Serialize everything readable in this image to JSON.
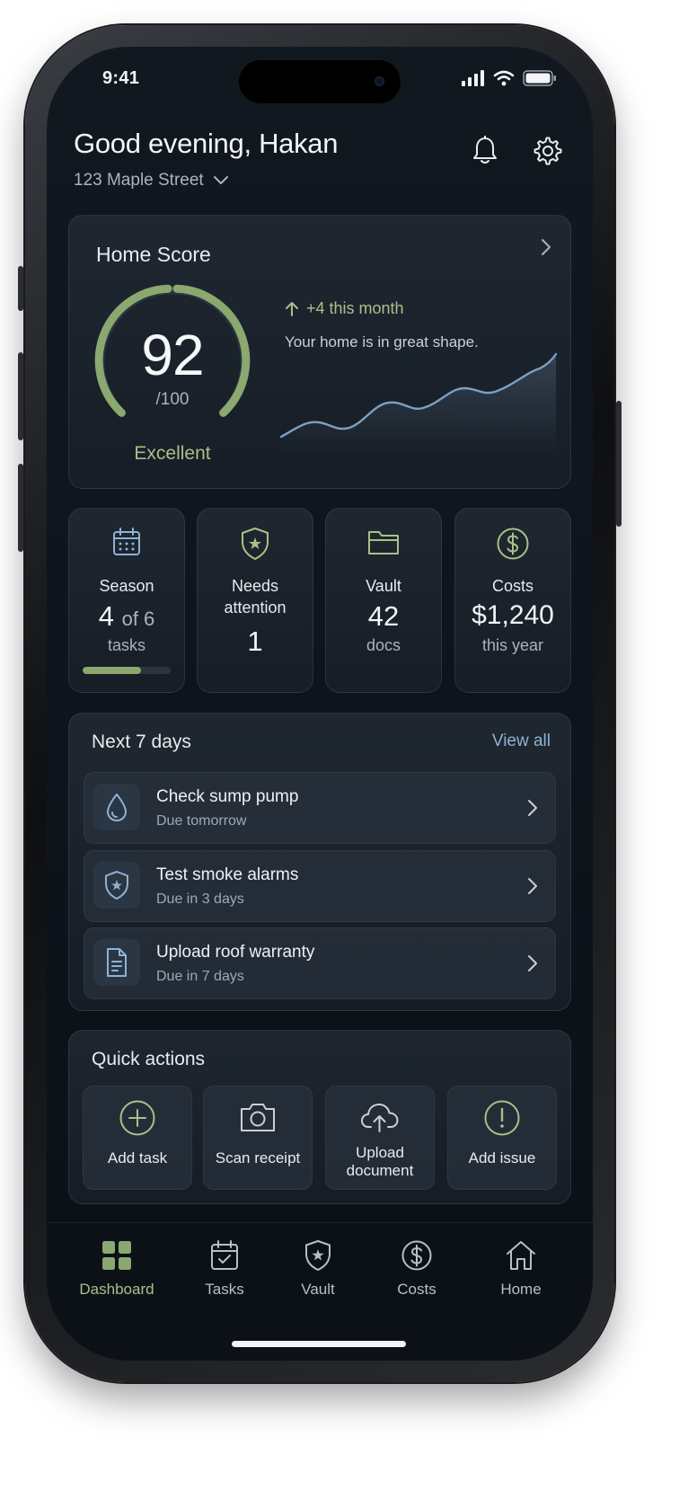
{
  "status_bar": {
    "time": "9:41"
  },
  "header": {
    "greeting": "Good evening, Hakan",
    "address": "123 Maple Street"
  },
  "home_score": {
    "title": "Home Score",
    "score": "92",
    "max": "/100",
    "rating": "Excellent",
    "score_fraction": 0.92,
    "trend": "+4 this month",
    "message": "Your home is in great shape."
  },
  "stats": {
    "season": {
      "title": "Season",
      "value": "4",
      "of": "of 6",
      "unit": "tasks",
      "progress": 0.667
    },
    "attention": {
      "title_line1": "Needs",
      "title_line2": "attention",
      "value": "1"
    },
    "vault": {
      "title": "Vault",
      "value": "42",
      "unit": "docs"
    },
    "costs": {
      "title": "Costs",
      "value": "$1,240",
      "unit": "this year"
    }
  },
  "next_days": {
    "title": "Next 7 days",
    "view_all": "View all",
    "tasks": [
      {
        "title": "Check sump pump",
        "due": "Due tomorrow"
      },
      {
        "title": "Test smoke alarms",
        "due": "Due in 3 days"
      },
      {
        "title": "Upload roof warranty",
        "due": "Due in 7 days"
      }
    ]
  },
  "quick_actions": {
    "title": "Quick actions",
    "items": [
      {
        "label": "Add task"
      },
      {
        "label": "Scan receipt"
      },
      {
        "label_line1": "Upload",
        "label_line2": "document"
      },
      {
        "label": "Add issue"
      }
    ]
  },
  "tabbar": {
    "tabs": [
      {
        "label": "Dashboard",
        "icon": "dashboard-icon",
        "active": true
      },
      {
        "label": "Tasks",
        "icon": "tasks-icon"
      },
      {
        "label": "Vault",
        "icon": "vault-icon"
      },
      {
        "label": "Costs",
        "icon": "costs-icon"
      },
      {
        "label": "Home",
        "icon": "home-icon"
      }
    ]
  },
  "colors": {
    "accent_green": "#a9c088",
    "link_blue": "#8eb2d6",
    "icon_blue": "#8eb2d6",
    "background": "#0e141b"
  }
}
